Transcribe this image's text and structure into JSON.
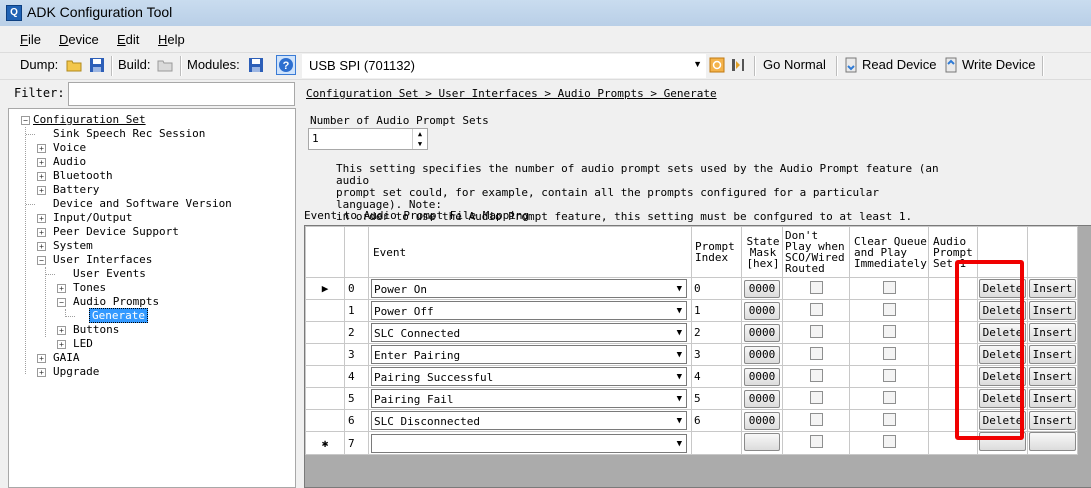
{
  "window": {
    "title": "ADK Configuration Tool"
  },
  "menu": [
    {
      "label": "File"
    },
    {
      "label": "Device"
    },
    {
      "label": "Edit"
    },
    {
      "label": "Help"
    }
  ],
  "toolbar": {
    "dump_label": "Dump:",
    "build_label": "Build:",
    "modules_label": "Modules:",
    "device_selected": "USB SPI (701132)",
    "go_normal": "Go Normal",
    "read_device": "Read Device",
    "write_device": "Write Device"
  },
  "filter": {
    "label": "Filter:",
    "value": ""
  },
  "tree": [
    {
      "label": "Configuration Set"
    },
    {
      "label": "Sink Speech Rec Session"
    },
    {
      "label": "Voice"
    },
    {
      "label": "Audio"
    },
    {
      "label": "Bluetooth"
    },
    {
      "label": "Battery"
    },
    {
      "label": "Device and Software Version"
    },
    {
      "label": "Input/Output"
    },
    {
      "label": "Peer Device Support"
    },
    {
      "label": "System"
    },
    {
      "label": "User Interfaces"
    },
    {
      "label": "User Events"
    },
    {
      "label": "Tones"
    },
    {
      "label": "Audio Prompts"
    },
    {
      "label": "Generate"
    },
    {
      "label": "Buttons"
    },
    {
      "label": "LED"
    },
    {
      "label": "GAIA"
    },
    {
      "label": "Upgrade"
    }
  ],
  "breadcrumb": "Configuration Set > User Interfaces > Audio Prompts > Generate",
  "num_sets": {
    "label": "Number of Audio Prompt Sets",
    "value": "1",
    "description_lines": [
      "This setting specifies the number of audio prompt sets used by the Audio Prompt feature (an audio",
      "prompt set could, for example, contain all the prompts configured for a particular language). Note:",
      "in order to use the Audio Prompt feature, this setting must be confgured to at least 1."
    ]
  },
  "mapping": {
    "label": "Event to Audio Prompt File Mapping",
    "headers": {
      "event": "Event",
      "prompt_index": "Prompt Index",
      "state_mask": "State Mask [hex]",
      "dont_play": "Don't Play when SCO/Wired Routed",
      "clear_queue": "Clear Queue and Play Immediately",
      "audio_prompt_set": "Audio Prompt Set 1"
    },
    "rows": [
      {
        "marker": "▶",
        "index": "0",
        "event": "Power On",
        "prompt_index": "0",
        "mask": "0000",
        "delete": "Delete",
        "insert": "Insert"
      },
      {
        "marker": "",
        "index": "1",
        "event": "Power Off",
        "prompt_index": "1",
        "mask": "0000",
        "delete": "Delete",
        "insert": "Insert"
      },
      {
        "marker": "",
        "index": "2",
        "event": "SLC Connected",
        "prompt_index": "2",
        "mask": "0000",
        "delete": "Delete",
        "insert": "Insert"
      },
      {
        "marker": "",
        "index": "3",
        "event": "Enter Pairing",
        "prompt_index": "3",
        "mask": "0000",
        "delete": "Delete",
        "insert": "Insert"
      },
      {
        "marker": "",
        "index": "4",
        "event": "Pairing Successful",
        "prompt_index": "4",
        "mask": "0000",
        "delete": "Delete",
        "insert": "Insert"
      },
      {
        "marker": "",
        "index": "5",
        "event": "Pairing Fail",
        "prompt_index": "5",
        "mask": "0000",
        "delete": "Delete",
        "insert": "Insert"
      },
      {
        "marker": "",
        "index": "6",
        "event": "SLC Disconnected",
        "prompt_index": "6",
        "mask": "0000",
        "delete": "Delete",
        "insert": "Insert"
      },
      {
        "marker": "✱",
        "index": "7",
        "event": "",
        "prompt_index": "",
        "mask": "",
        "delete": "",
        "insert": ""
      }
    ]
  },
  "colors": {
    "highlight": "#f00000",
    "titlebar": "#c9dcef",
    "selected_node": "#3399ff"
  }
}
